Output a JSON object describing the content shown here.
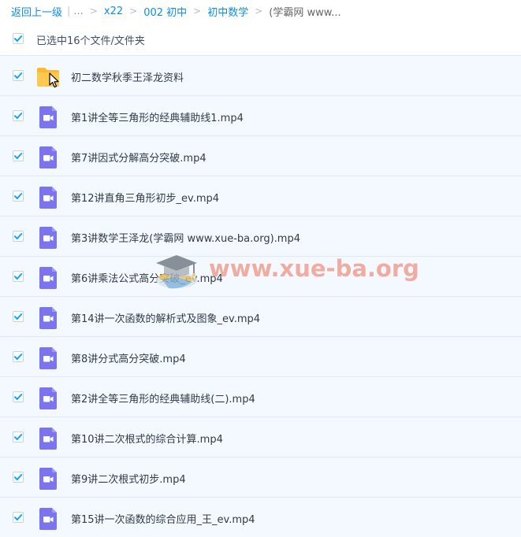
{
  "breadcrumb": {
    "back_label": "返回上一级",
    "ellipsis": "...",
    "items": [
      "x22",
      "002 初中",
      "初中数学"
    ],
    "current": "(学霸网 www..."
  },
  "selection": {
    "checked": true,
    "count_label": "已选中16个文件/文件夹"
  },
  "files": [
    {
      "name": "初二数学秋季王泽龙资料",
      "type": "folder",
      "icon": "folder-icon",
      "checked": true
    },
    {
      "name": "第1讲全等三角形的经典辅助线1.mp4",
      "type": "video",
      "icon": "video-file-icon",
      "checked": true
    },
    {
      "name": "第7讲因式分解高分突破.mp4",
      "type": "video",
      "icon": "video-file-icon",
      "checked": true
    },
    {
      "name": "第12讲直角三角形初步_ev.mp4",
      "type": "video",
      "icon": "video-file-icon",
      "checked": true
    },
    {
      "name": "第3讲数学王泽龙(学霸网 www.xue-ba.org).mp4",
      "type": "video",
      "icon": "video-file-icon",
      "checked": true
    },
    {
      "name": "第6讲乘法公式高分突破_ev.mp4",
      "type": "video",
      "icon": "video-file-icon",
      "checked": true
    },
    {
      "name": "第14讲一次函数的解析式及图象_ev.mp4",
      "type": "video",
      "icon": "video-file-icon",
      "checked": true
    },
    {
      "name": "第8讲分式高分突破.mp4",
      "type": "video",
      "icon": "video-file-icon",
      "checked": true
    },
    {
      "name": "第2讲全等三角形的经典辅助线(二).mp4",
      "type": "video",
      "icon": "video-file-icon",
      "checked": true
    },
    {
      "name": "第10讲二次根式的综合计算.mp4",
      "type": "video",
      "icon": "video-file-icon",
      "checked": true
    },
    {
      "name": "第9讲二次根式初步.mp4",
      "type": "video",
      "icon": "video-file-icon",
      "checked": true
    },
    {
      "name": "第15讲一次函数的综合应用_王_ev.mp4",
      "type": "video",
      "icon": "video-file-icon",
      "checked": true
    }
  ],
  "watermark": {
    "text": "www.xue-ba.org",
    "icon": "graduation-cap-logo"
  },
  "colors": {
    "link": "#0d8de5",
    "checkbox": "#06a7ff",
    "row_background": "#f3f9fe",
    "row_border": "#dfeaf6",
    "folder": "#ffc54d",
    "video_icon": "#7b74ee",
    "watermark": "#ef8f7d"
  }
}
